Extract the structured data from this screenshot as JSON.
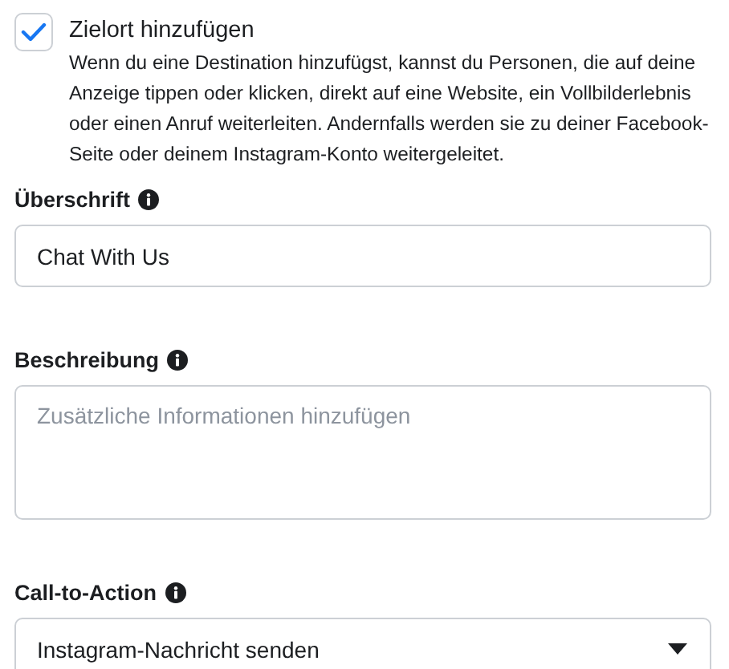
{
  "destination": {
    "label": "Zielort hinzufügen",
    "checked": true,
    "description": "Wenn du eine Destination hinzufügst, kannst du Personen, die auf deine Anzeige tippen oder klicken, direkt auf eine Website, ein Vollbilderlebnis oder einen Anruf weiterleiten. Andernfalls werden sie zu deiner Facebook-Seite oder deinem Instagram-Konto weitergeleitet."
  },
  "fields": [
    {
      "kind": "text",
      "label": "Überschrift",
      "value": "Chat With Us"
    },
    {
      "kind": "textarea",
      "label": "Beschreibung",
      "placeholder": "Zusätzliche Informationen hinzufügen"
    },
    {
      "kind": "select",
      "label": "Call-to-Action",
      "value": "Instagram-Nachricht senden"
    }
  ]
}
